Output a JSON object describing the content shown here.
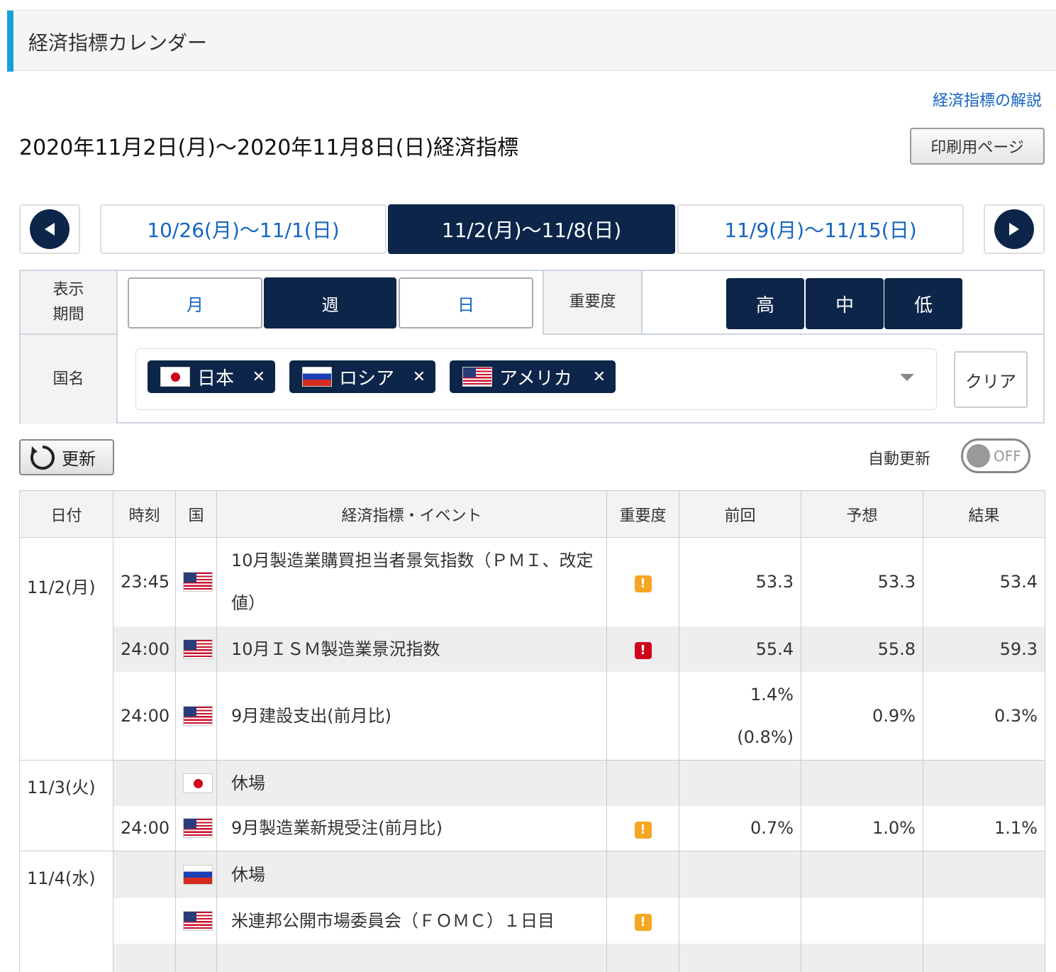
{
  "header": {
    "title": "経済指標カレンダー"
  },
  "help_link": "経済指標の解説",
  "page_title": "2020年11月2日(月)〜2020年11月8日(日)経済指標",
  "print_button": "印刷用ページ",
  "weeks": {
    "prev": "10/26(月)〜11/1(日)",
    "current": "11/2(月)〜11/8(日)",
    "next": "11/9(月)〜11/15(日)"
  },
  "filter": {
    "period_label_1": "表示",
    "period_label_2": "期間",
    "periods": [
      "月",
      "週",
      "日"
    ],
    "importance_label": "重要度",
    "importance": [
      "高",
      "中",
      "低"
    ],
    "country_label": "国名",
    "countries": [
      "日本",
      "ロシア",
      "アメリカ"
    ],
    "clear": "クリア"
  },
  "refresh": "更新",
  "auto_refresh": {
    "label": "自動更新",
    "state": "OFF"
  },
  "table": {
    "headers": [
      "日付",
      "時刻",
      "国",
      "経済指標・イベント",
      "重要度",
      "前回",
      "予想",
      "結果"
    ],
    "rows": [
      {
        "date": "11/2(月)",
        "time": "23:45",
        "country": "us",
        "event": "10月製造業購買担当者景気指数（ＰＭＩ、改定値）",
        "importance": "mid",
        "prev": "53.3",
        "forecast": "53.3",
        "result": "53.4"
      },
      {
        "date": "",
        "time": "24:00",
        "country": "us",
        "event": "10月ＩＳＭ製造業景況指数",
        "importance": "high",
        "prev": "55.4",
        "forecast": "55.8",
        "result": "59.3"
      },
      {
        "date": "",
        "time": "24:00",
        "country": "us",
        "event": "9月建設支出(前月比)",
        "importance": "",
        "prev": "1.4%",
        "prev2": "(0.8%)",
        "forecast": "0.9%",
        "result": "0.3%"
      },
      {
        "date": "11/3(火)",
        "time": "",
        "country": "jp",
        "event": "休場",
        "importance": "",
        "prev": "",
        "forecast": "",
        "result": ""
      },
      {
        "date": "",
        "time": "24:00",
        "country": "us",
        "event": "9月製造業新規受注(前月比)",
        "importance": "mid",
        "prev": "0.7%",
        "forecast": "1.0%",
        "result": "1.1%"
      },
      {
        "date": "11/4(水)",
        "time": "",
        "country": "ru",
        "event": "休場",
        "importance": "",
        "prev": "",
        "forecast": "",
        "result": ""
      },
      {
        "date": "",
        "time": "",
        "country": "us",
        "event": "米連邦公開市場委員会（ＦＯＭＣ）１日目",
        "importance": "mid",
        "prev": "",
        "forecast": "",
        "result": ""
      }
    ]
  },
  "colors": {
    "accent": "#1aa0d8",
    "navy": "#0c2549",
    "link": "#1565c0",
    "importance_mid": "#f5a623",
    "importance_high": "#d0021b"
  }
}
